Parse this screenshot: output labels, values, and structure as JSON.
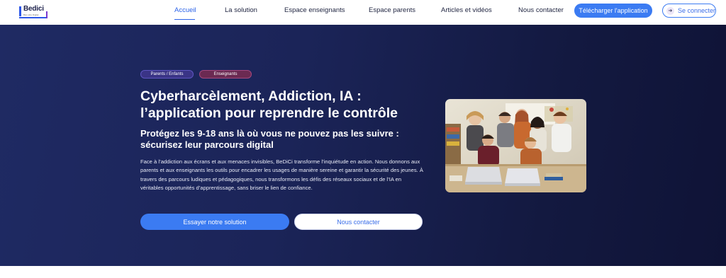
{
  "header": {
    "logo": {
      "brand": "Bedici",
      "tagline": "Bien-être Digital"
    },
    "nav": [
      {
        "label": "Accueil",
        "active": true
      },
      {
        "label": "La solution"
      },
      {
        "label": "Espace enseignants"
      },
      {
        "label": "Espace parents"
      },
      {
        "label": "Articles et vidéos"
      },
      {
        "label": "Nous contacter"
      }
    ],
    "download_label": "Télécharger l'application",
    "login_label": "Se connecter"
  },
  "hero": {
    "tags": [
      "Parents / Enfants",
      "Enseignants"
    ],
    "title_line1": "Cyberharcèlement, Addiction, IA :",
    "title_line2": "l’application pour reprendre le contrôle",
    "subtitle_line1": "Protégez les 9-18 ans là où vous ne pouvez pas les suivre :",
    "subtitle_line2": "sécurisez leur parcours digital",
    "description": "Face à l’addiction aux écrans et aux menaces invisibles, BeDiCi transforme l’inquiétude en action. Nous donnons aux parents et aux enseignants les outils pour encadrer les usages de manière sereine et garantir la sécurité des jeunes. À travers des parcours ludiques et pédagogiques, nous transformons les défis des réseaux sociaux et de l’IA en véritables opportunités d’apprentissage, sans briser le lien de confiance.",
    "primary_cta": "Essayer notre solution",
    "secondary_cta": "Nous contacter"
  },
  "colors": {
    "accent": "#3b7bf2",
    "hero_bg": "#1b2458",
    "tag_parents": "#3a3486",
    "tag_teachers": "#6b2a52"
  }
}
